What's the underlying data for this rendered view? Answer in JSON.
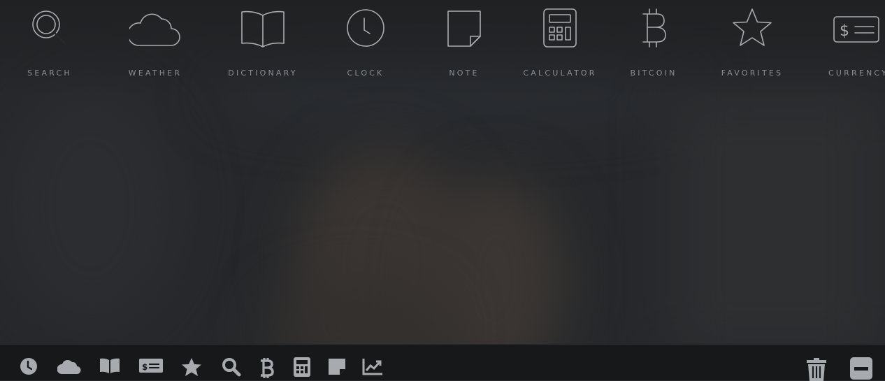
{
  "apps": [
    {
      "label": "SEARCH",
      "icon": "search-icon"
    },
    {
      "label": "WEATHER",
      "icon": "cloud-icon"
    },
    {
      "label": "DICTIONARY",
      "icon": "book-icon"
    },
    {
      "label": "CLOCK",
      "icon": "clock-icon"
    },
    {
      "label": "NOTE",
      "icon": "note-icon"
    },
    {
      "label": "CALCULATOR",
      "icon": "calculator-icon"
    },
    {
      "label": "BITCOIN",
      "icon": "bitcoin-icon"
    },
    {
      "label": "FAVORITES",
      "icon": "star-icon"
    },
    {
      "label": "CURRENCY",
      "icon": "currency-icon"
    }
  ],
  "dock": {
    "items": [
      "clock-icon",
      "cloud-icon",
      "book-icon",
      "currency-icon",
      "star-icon",
      "search-icon",
      "bitcoin-icon",
      "calculator-icon",
      "note-icon",
      "chart-icon"
    ],
    "right": [
      "trash-icon",
      "minimize-icon"
    ]
  },
  "colors": {
    "icon": "#a9adb1",
    "label": "#8b8f94",
    "dock": "#17181a",
    "background": "#26282b"
  }
}
